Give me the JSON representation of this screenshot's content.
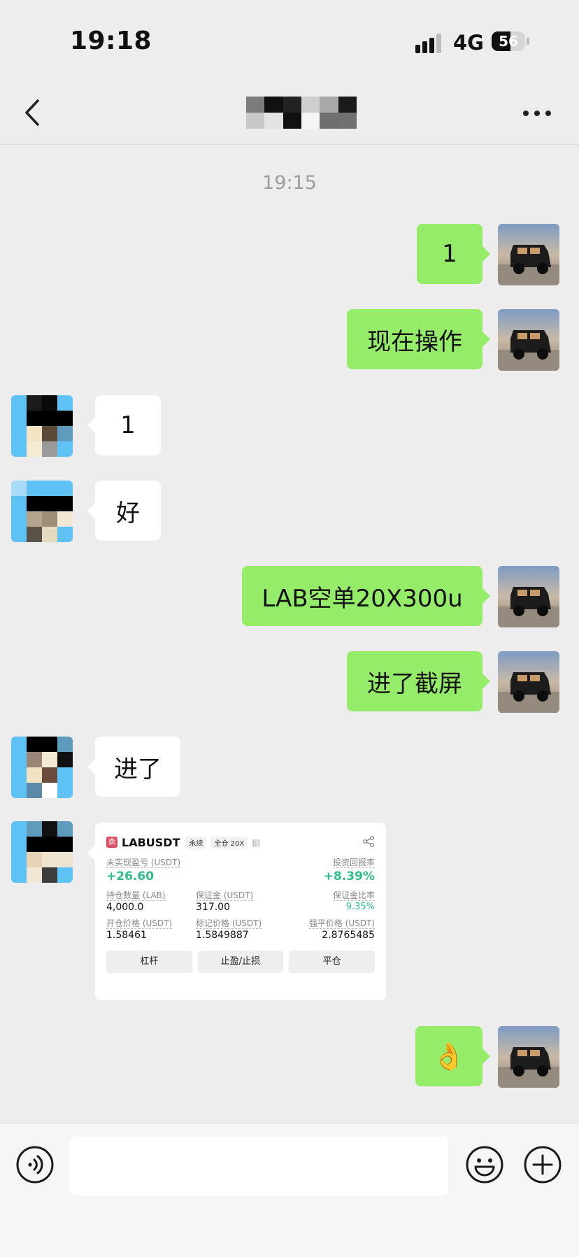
{
  "status_bar": {
    "time": "19:18",
    "network": "4G",
    "battery": "56"
  },
  "chat": {
    "timestamp": "19:15",
    "messages": [
      {
        "direction": "out",
        "text": "1"
      },
      {
        "direction": "out",
        "text": "现在操作"
      },
      {
        "direction": "in",
        "text": "1"
      },
      {
        "direction": "in",
        "text": "好"
      },
      {
        "direction": "out",
        "text": "LAB空单20X300u"
      },
      {
        "direction": "out",
        "text": "进了截屏"
      },
      {
        "direction": "in",
        "text": "进了"
      },
      {
        "direction": "out",
        "text": "👌"
      }
    ]
  },
  "trade_card": {
    "side_tag": "卖",
    "symbol": "LABUSDT",
    "tag_perpetual": "永续",
    "tag_margin": "全仓 20X",
    "bars": "||||",
    "unrealized_pnl_label": "未实现盈亏 (USDT)",
    "unrealized_pnl_value": "+26.60",
    "roi_label": "投资回报率",
    "roi_value": "+8.39%",
    "position_label": "持仓数量 (LAB)",
    "position_value": "4,000.0",
    "margin_label": "保证金 (USDT)",
    "margin_value": "317.00",
    "margin_ratio_label": "保证金比率",
    "margin_ratio_value": "9.35%",
    "entry_price_label": "开仓价格 (USDT)",
    "entry_price_value": "1.58461",
    "mark_price_label": "标记价格 (USDT)",
    "mark_price_value": "1.5849887",
    "liq_price_label": "强平价格 (USDT)",
    "liq_price_value": "2.8765485",
    "buttons": [
      "杠杆",
      "止盈/止损",
      "平仓"
    ]
  },
  "colors": {
    "outgoing_bubble": "#95ec69",
    "incoming_bubble": "#ffffff",
    "profit_green": "#2ebd85",
    "background": "#ededed"
  }
}
